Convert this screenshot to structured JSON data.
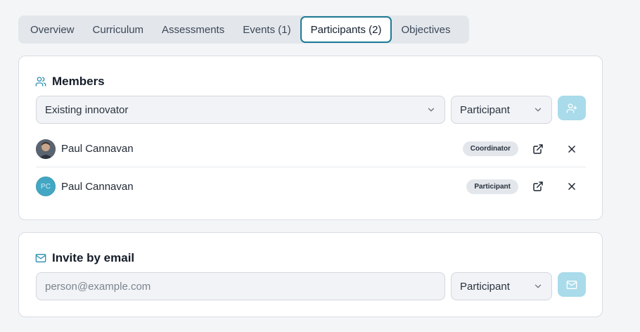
{
  "tabs": [
    {
      "label": "Overview"
    },
    {
      "label": "Curriculum"
    },
    {
      "label": "Assessments"
    },
    {
      "label": "Events (1)"
    },
    {
      "label": "Participants (2)",
      "active": true
    },
    {
      "label": "Objectives"
    }
  ],
  "members": {
    "title": "Members",
    "innovator_select": "Existing innovator",
    "role_select": "Participant",
    "rows": [
      {
        "name": "Paul Cannavan",
        "role": "Coordinator",
        "avatar": "photo"
      },
      {
        "name": "Paul Cannavan",
        "role": "Participant",
        "avatar": "initials",
        "initials": "PC"
      }
    ]
  },
  "invite": {
    "title": "Invite by email",
    "email_placeholder": "person@example.com",
    "email_value": "",
    "role_select": "Participant"
  },
  "colors": {
    "accent": "#1f7a96",
    "button_bg": "#a9dbea",
    "icon_teal": "#2b8fae"
  },
  "icons": {
    "members": "users-icon",
    "invite": "mail-icon",
    "add": "user-plus-icon",
    "send": "mail-icon",
    "open": "external-link-icon",
    "remove": "close-icon",
    "dropdown": "chevron-down-icon"
  }
}
